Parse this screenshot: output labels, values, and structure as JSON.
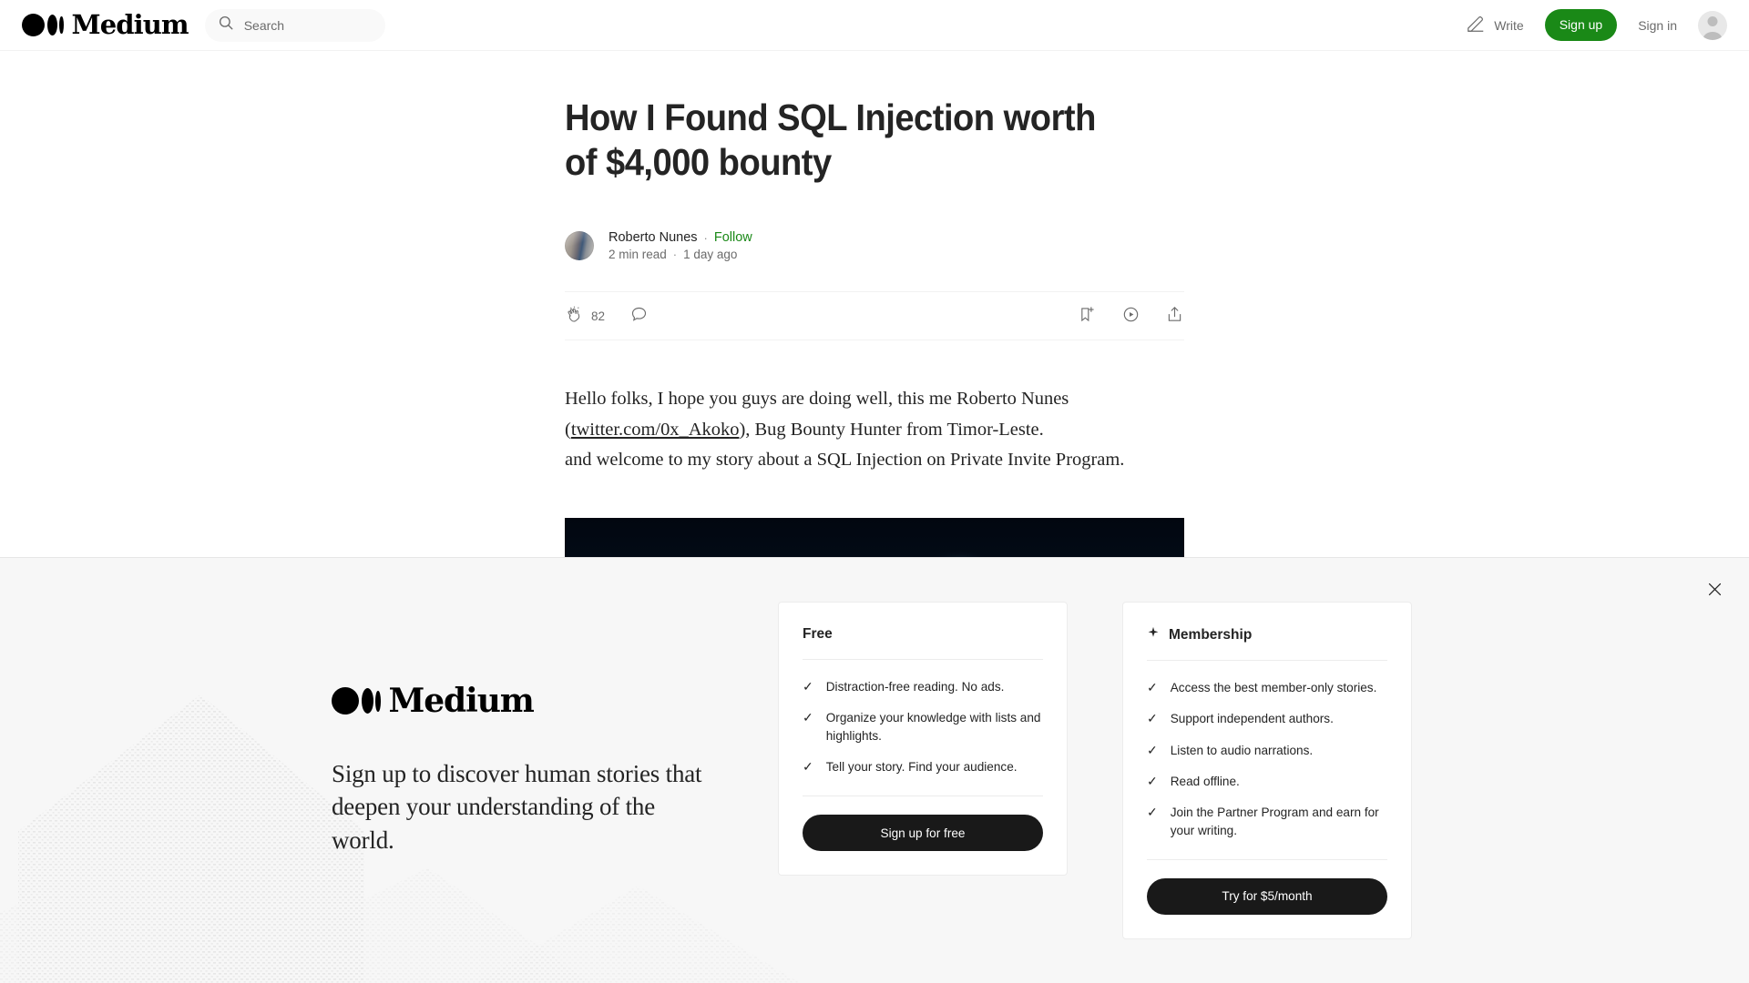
{
  "header": {
    "logo_text": "Medium",
    "search_placeholder": "Search",
    "write_label": "Write",
    "signup_label": "Sign up",
    "signin_label": "Sign in"
  },
  "article": {
    "title": "How I Found SQL Injection worth of $4,000 bounty",
    "author": "Roberto Nunes",
    "follow_label": "Follow",
    "read_time": "2 min read",
    "published": "1 day ago",
    "byline_separator": "·",
    "clap_count": "82",
    "paragraph_line1": "Hello folks, I hope you guys are doing well, this me Roberto Nunes",
    "paragraph_open_paren": "(",
    "paragraph_link": "twitter.com/0x_Akoko",
    "paragraph_line2_rest": "), Bug Bounty Hunter from Timor-Leste.",
    "paragraph_line3": "and welcome to my story about a SQL Injection on Private Invite Program."
  },
  "banner": {
    "logo_text": "Medium",
    "headline": "Sign up to discover human stories that deepen your understanding of the world.",
    "free_card": {
      "title": "Free",
      "features": [
        "Distraction-free reading. No ads.",
        "Organize your knowledge with lists and highlights.",
        "Tell your story. Find your audience."
      ],
      "button": "Sign up for free"
    },
    "membership_card": {
      "title": "Membership",
      "features": [
        "Access the best member-only stories.",
        "Support independent authors.",
        "Listen to audio narrations.",
        "Read offline.",
        "Join the Partner Program and earn for your writing."
      ],
      "button": "Try for $5/month"
    }
  },
  "colors": {
    "brand_green": "#1a8917",
    "text_primary": "#242424",
    "text_muted": "#6b6b6b",
    "banner_bg": "#f7f7f7",
    "button_dark": "#191919"
  }
}
